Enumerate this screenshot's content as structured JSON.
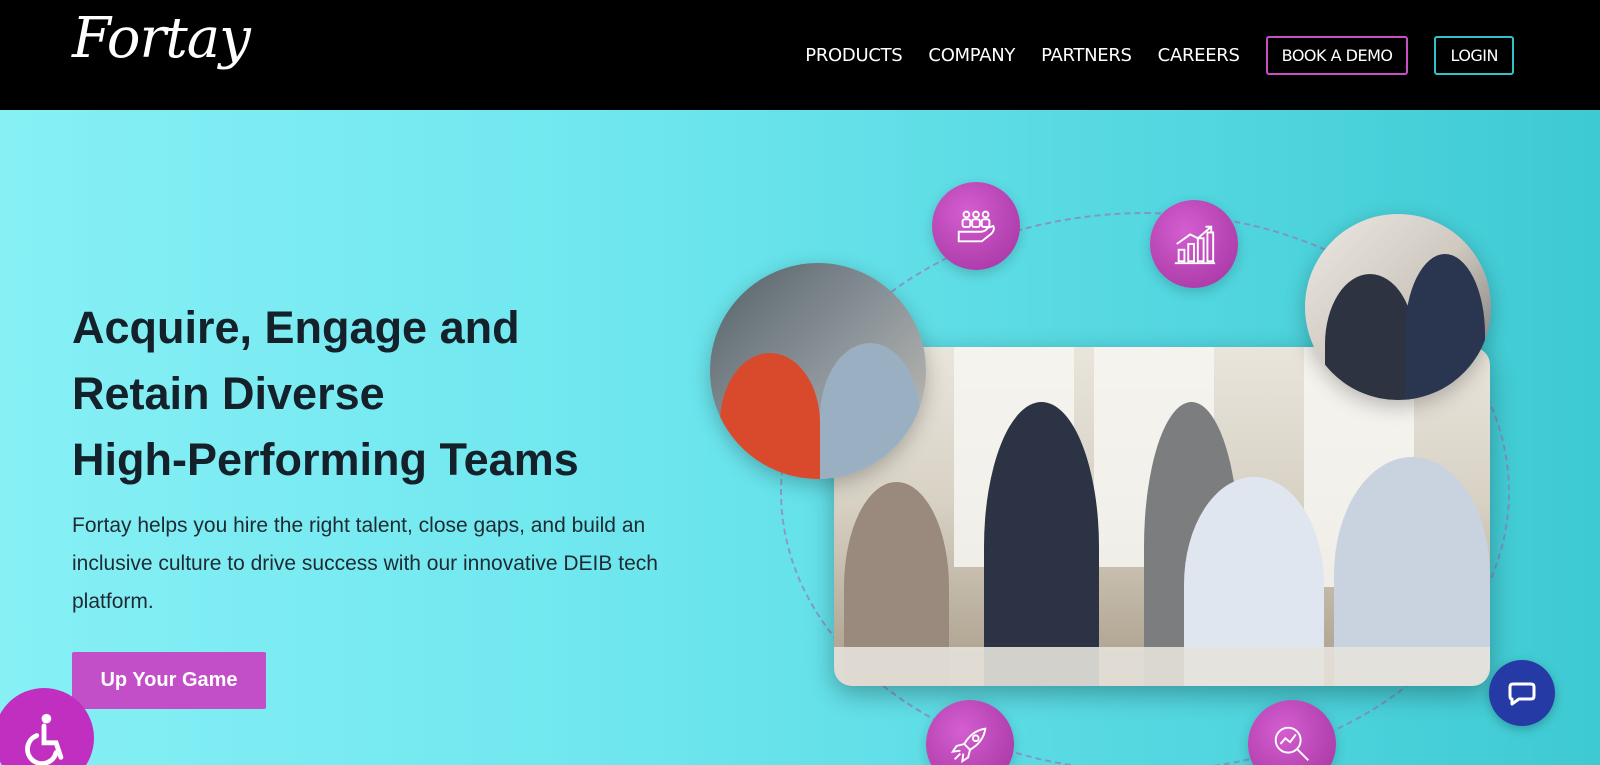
{
  "brand": {
    "logo_text": "Fortay"
  },
  "nav": {
    "links": [
      "PRODUCTS",
      "COMPANY",
      "PARTNERS",
      "CAREERS"
    ],
    "book_demo": "BOOK A DEMO",
    "login": "LOGIN"
  },
  "hero": {
    "headline_lines": [
      "Acquire, Engage and",
      "Retain Diverse",
      "High-Performing Teams"
    ],
    "description": "Fortay helps you hire the right talent, close gaps, and build an inclusive culture to drive success with our innovative DEIB tech platform.",
    "cta_label": "Up Your Game"
  },
  "icons": {
    "bubbles": [
      "team-hand-icon",
      "growth-chart-icon",
      "rocket-icon",
      "analytics-magnifier-icon"
    ],
    "accessibility": "accessibility-icon",
    "chat": "chat-icon"
  },
  "colors": {
    "header_bg": "#000000",
    "accent_magenta": "#c24fc8",
    "accent_teal": "#34c2c9",
    "chat_blue": "#263aa6",
    "hero_gradient_start": "#86f0f5",
    "hero_gradient_end": "#3ecad3"
  }
}
